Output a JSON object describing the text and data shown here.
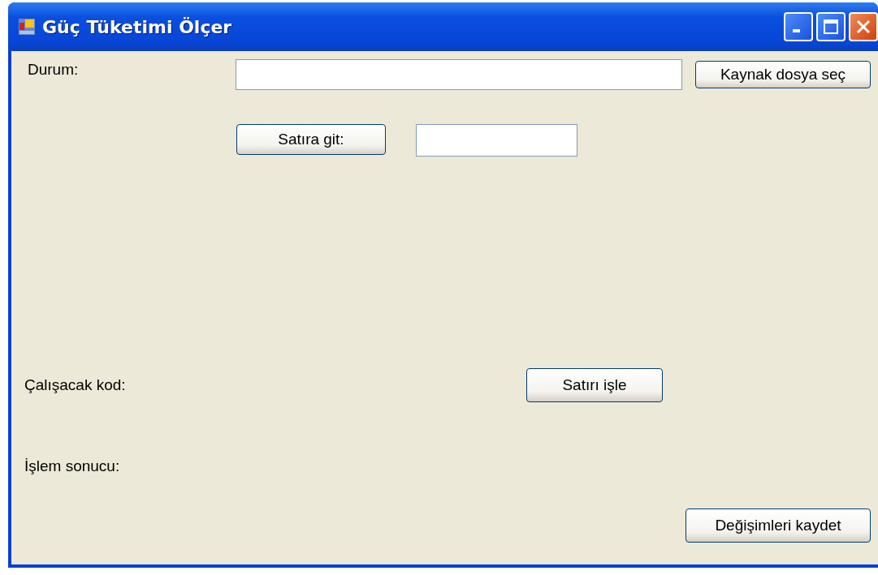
{
  "window": {
    "title": "Güç Tüketimi Ölçer"
  },
  "source_row": {
    "label": "Durum:",
    "button": "Kaynak dosya seç"
  },
  "goto_row": {
    "button": "Satıra git:"
  },
  "code_row": {
    "label": "Çalışacak kod:",
    "button": "Satırı işle"
  },
  "result_row": {
    "label": "İşlem sonucu:"
  },
  "save_button": "Değişimleri kaydet"
}
